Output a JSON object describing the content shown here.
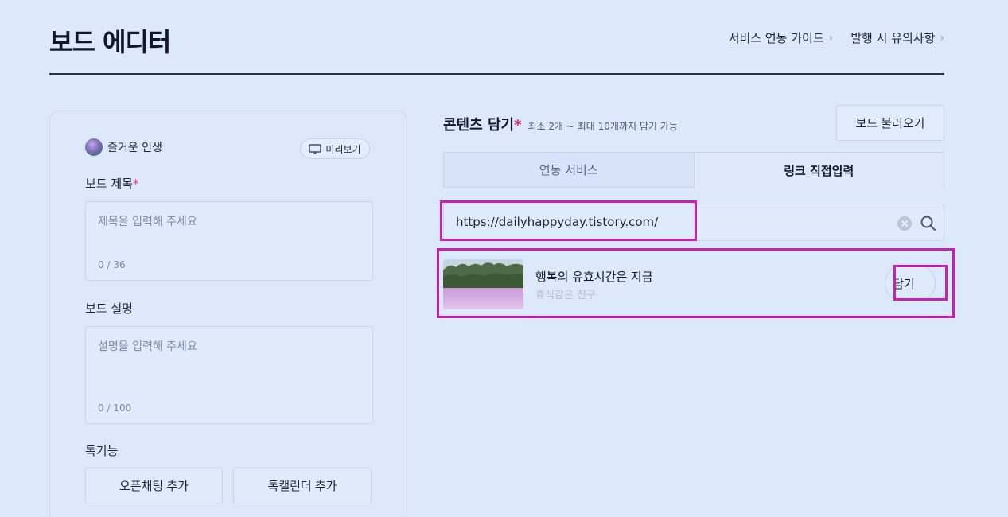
{
  "header": {
    "title": "보드 에디터",
    "links": [
      {
        "label": "서비스 연동 가이드"
      },
      {
        "label": "발행 시 유의사항"
      }
    ]
  },
  "editor": {
    "profile_name": "즐거운 인생",
    "preview_label": "미리보기",
    "board_title": {
      "label": "보드 제목",
      "required_mark": "*",
      "placeholder": "제목을 입력해 주세요",
      "count": "0 / 36"
    },
    "board_description": {
      "label": "보드 설명",
      "placeholder": "설명을 입력해 주세요",
      "count": "0 / 100"
    },
    "talk_features": {
      "label": "톡기능",
      "buttons": [
        "오픈채팅 추가",
        "톡캘린더 추가"
      ]
    }
  },
  "contents": {
    "title": "콘텐츠 담기",
    "required_mark": "*",
    "subtitle": "최소 2개 ~ 최대 10개까지 담기 가능",
    "load_board_label": "보드 불러오기",
    "tabs": [
      {
        "label": "연동 서비스",
        "active": false
      },
      {
        "label": "링크 직접입력",
        "active": true
      }
    ],
    "url_input_value": "https://dailyhappyday.tistory.com/",
    "result": {
      "title": "행복의 유효시간은 지금",
      "subtitle": "휴식같은 친구",
      "add_label": "담기"
    }
  },
  "colors": {
    "background": "#dce8fb",
    "required": "#e0245e",
    "highlight": "#c81fb7"
  },
  "icons": [
    "chevron-right-icon",
    "monitor-icon",
    "clear-icon",
    "search-icon"
  ]
}
